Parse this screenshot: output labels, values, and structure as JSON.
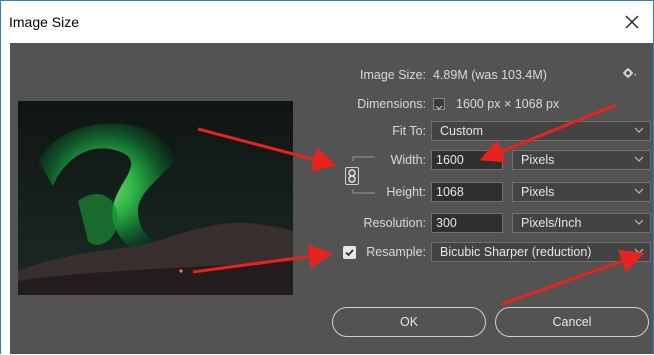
{
  "dialog": {
    "title": "Image Size",
    "close_icon": "close-icon"
  },
  "info": {
    "image_size_label": "Image Size:",
    "image_size_value": "4.89M (was 103.4M)",
    "settings_icon": "gear-icon",
    "dimensions_label": "Dimensions:",
    "dimensions_value": "1600 px  ×  1068 px"
  },
  "fit_to": {
    "label": "Fit To:",
    "value": "Custom"
  },
  "width": {
    "label": "Width:",
    "value": "1600",
    "unit": "Pixels"
  },
  "height": {
    "label": "Height:",
    "value": "1068",
    "unit": "Pixels"
  },
  "resolution": {
    "label": "Resolution:",
    "value": "300",
    "unit": "Pixels/Inch"
  },
  "resample": {
    "label": "Resample:",
    "checked": true,
    "value": "Bicubic Sharper (reduction)"
  },
  "buttons": {
    "ok": "OK",
    "cancel": "Cancel"
  },
  "colors": {
    "panel": "#535353",
    "arrow": "#e8221c",
    "title_border": "#2a7fd4"
  }
}
